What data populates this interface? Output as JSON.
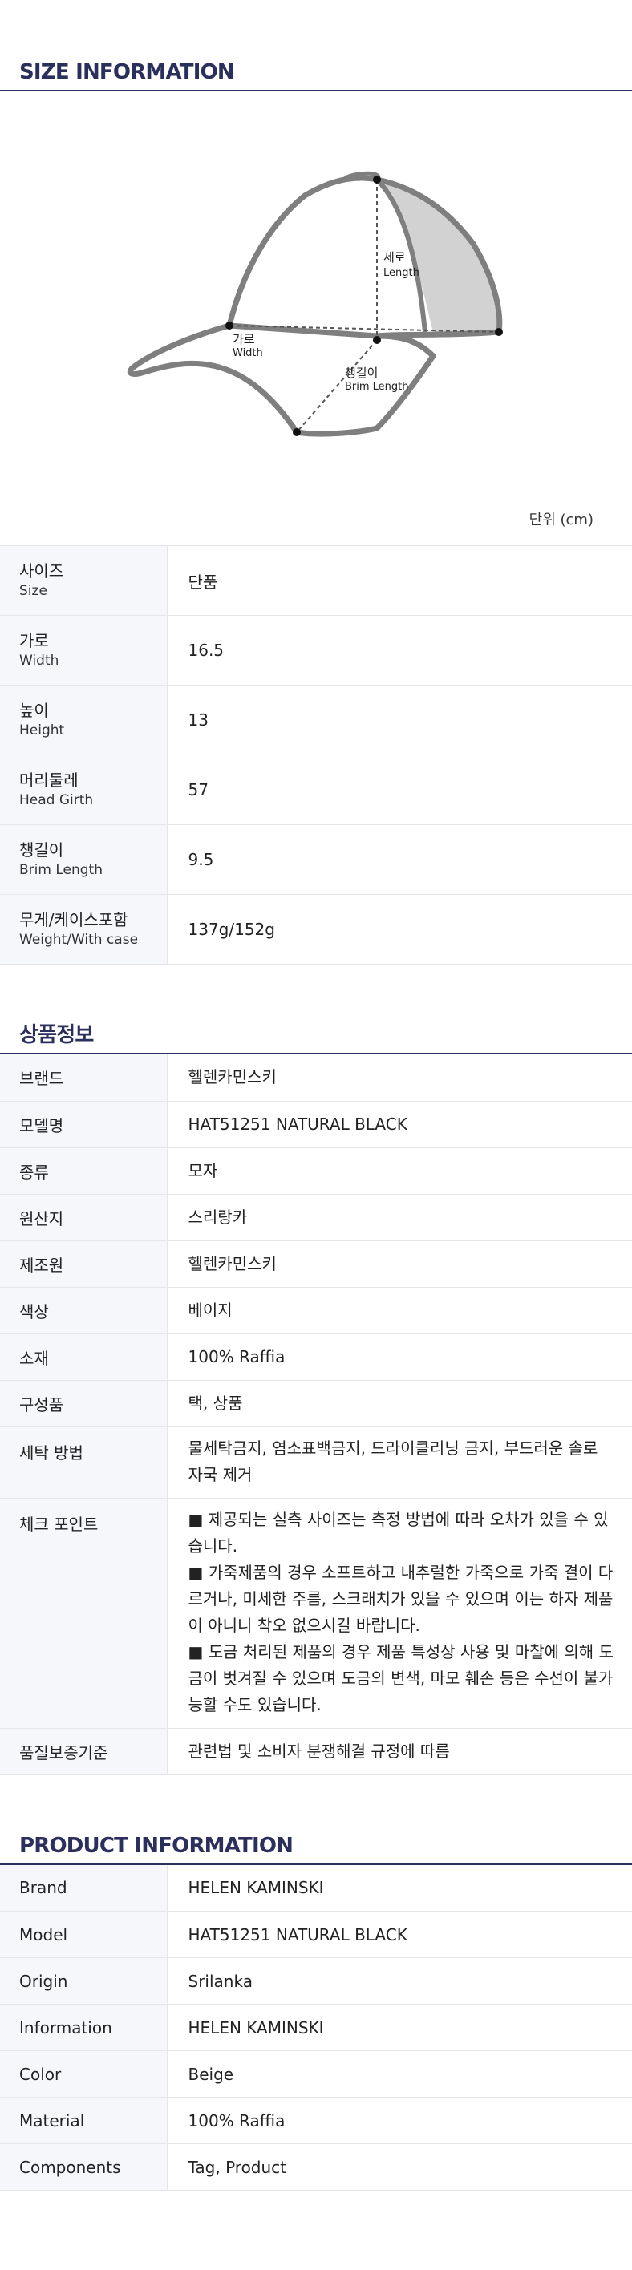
{
  "size_info": {
    "title": "SIZE INFORMATION",
    "diagram": {
      "height_ko": "세로",
      "height_en": "Length",
      "width_ko": "가로",
      "width_en": "Width",
      "brim_ko": "챙길이",
      "brim_en": "Brim Length"
    },
    "unit": "단위 (cm)",
    "rows": [
      {
        "ko": "사이즈",
        "en": "Size",
        "value": "단품"
      },
      {
        "ko": "가로",
        "en": "Width",
        "value": "16.5"
      },
      {
        "ko": "높이",
        "en": "Height",
        "value": "13"
      },
      {
        "ko": "머리둘레",
        "en": "Head Girth",
        "value": "57"
      },
      {
        "ko": "챙길이",
        "en": "Brim Length",
        "value": "9.5"
      },
      {
        "ko": "무게/케이스포함",
        "en": "Weight/With case",
        "value": "137g/152g"
      }
    ]
  },
  "product_info_ko": {
    "title": "상품정보",
    "rows": [
      {
        "label": "브랜드",
        "value": "헬렌카민스키"
      },
      {
        "label": "모델명",
        "value": "HAT51251 NATURAL BLACK"
      },
      {
        "label": "종류",
        "value": "모자"
      },
      {
        "label": "원산지",
        "value": "스리랑카"
      },
      {
        "label": "제조원",
        "value": "헬렌카민스키"
      },
      {
        "label": "색상",
        "value": "베이지"
      },
      {
        "label": "소재",
        "value": "100% Raffia"
      },
      {
        "label": "구성품",
        "value": "택, 상품"
      },
      {
        "label": "세탁 방법",
        "value": "물세탁금지, 염소표백금지, 드라이클리닝 금지, 부드러운 솔로 자국 제거"
      },
      {
        "label": "체크 포인트",
        "lines": [
          " ■ 제공되는 실측 사이즈는 측정 방법에 따라 오차가 있을 수 있습니다.",
          " ■ 가죽제품의 경우 소프트하고 내추럴한 가죽으로 가죽 결이 다르거나, 미세한 주름, 스크래치가 있을 수 있으며 이는 하자 제품이 아니니 착오 없으시길 바랍니다.",
          " ■ 도금 처리된 제품의 경우 제품 특성상 사용 및 마찰에 의해 도금이 벗겨질 수 있으며 도금의 변색, 마모 훼손 등은 수선이 불가능할 수도 있습니다."
        ]
      },
      {
        "label": "품질보증기준",
        "value": "관련법 및 소비자 분쟁해결 규정에 따름"
      }
    ]
  },
  "product_info_en": {
    "title": "PRODUCT INFORMATION",
    "rows": [
      {
        "label": "Brand",
        "value": "HELEN KAMINSKI"
      },
      {
        "label": "Model",
        "value": "HAT51251 NATURAL BLACK"
      },
      {
        "label": "Origin",
        "value": "Srilanka"
      },
      {
        "label": "Information",
        "value": "HELEN KAMINSKI"
      },
      {
        "label": "Color",
        "value": "Beige"
      },
      {
        "label": "Material",
        "value": "100% Raffia"
      },
      {
        "label": "Components",
        "value": "Tag, Product"
      }
    ]
  }
}
